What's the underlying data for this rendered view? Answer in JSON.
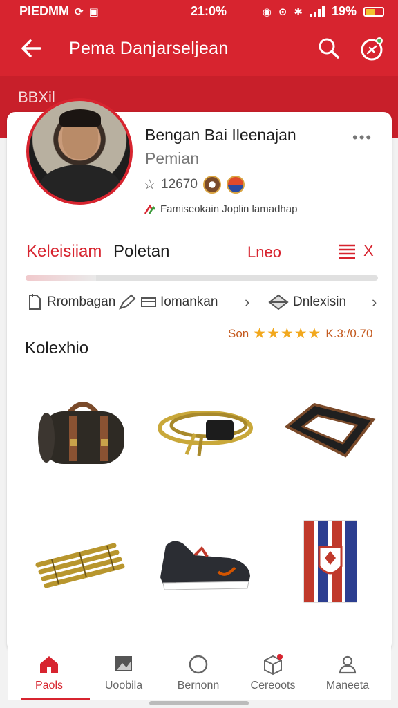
{
  "status_bar": {
    "left": "PIEDMM",
    "time": "21:0%",
    "battery": "19%",
    "battery_level": 0.55,
    "battery_color": "#f2c230"
  },
  "app_bar": {
    "title": "Pema Danjarseljean",
    "back_icon": "arrow-left-icon",
    "search_icon": "search-icon",
    "action_icon": "ticket-icon"
  },
  "band_label": "BBXil",
  "profile": {
    "name": "Bengan Bai Ileenajan",
    "role": "Pemian",
    "rating_text": "12670",
    "note": "Famiseokain Joplin lamadhap"
  },
  "section": {
    "title_first": "Keleisiiam",
    "title_second": "Poletan",
    "link": "Lneo",
    "close": "X"
  },
  "progress": {
    "value": 0.2
  },
  "actions": {
    "a1": "Rrombagan",
    "a2": "Iomankan",
    "a3": "Dnlexisin"
  },
  "stats": {
    "prefix": "Son",
    "stars": "★★★★★",
    "rating_value": 5,
    "suffix": "K.3:/0.70"
  },
  "collection_title": "Kolexhio",
  "items": [
    {
      "name": "leather-duffel-bag"
    },
    {
      "name": "coiled-gold-cable"
    },
    {
      "name": "leather-strap-loop"
    },
    {
      "name": "brass-pipes"
    },
    {
      "name": "sneaker"
    },
    {
      "name": "striped-banner"
    }
  ],
  "bottom_nav": [
    {
      "label": "Paols",
      "icon": "home-icon"
    },
    {
      "label": "Uoobila",
      "icon": "image-icon"
    },
    {
      "label": "Bernonn",
      "icon": "circle-icon"
    },
    {
      "label": "Cereoots",
      "icon": "box-icon"
    },
    {
      "label": "Maneeta",
      "icon": "user-icon"
    }
  ],
  "colors": {
    "primary": "#d7242f",
    "star": "#f2a81d"
  }
}
